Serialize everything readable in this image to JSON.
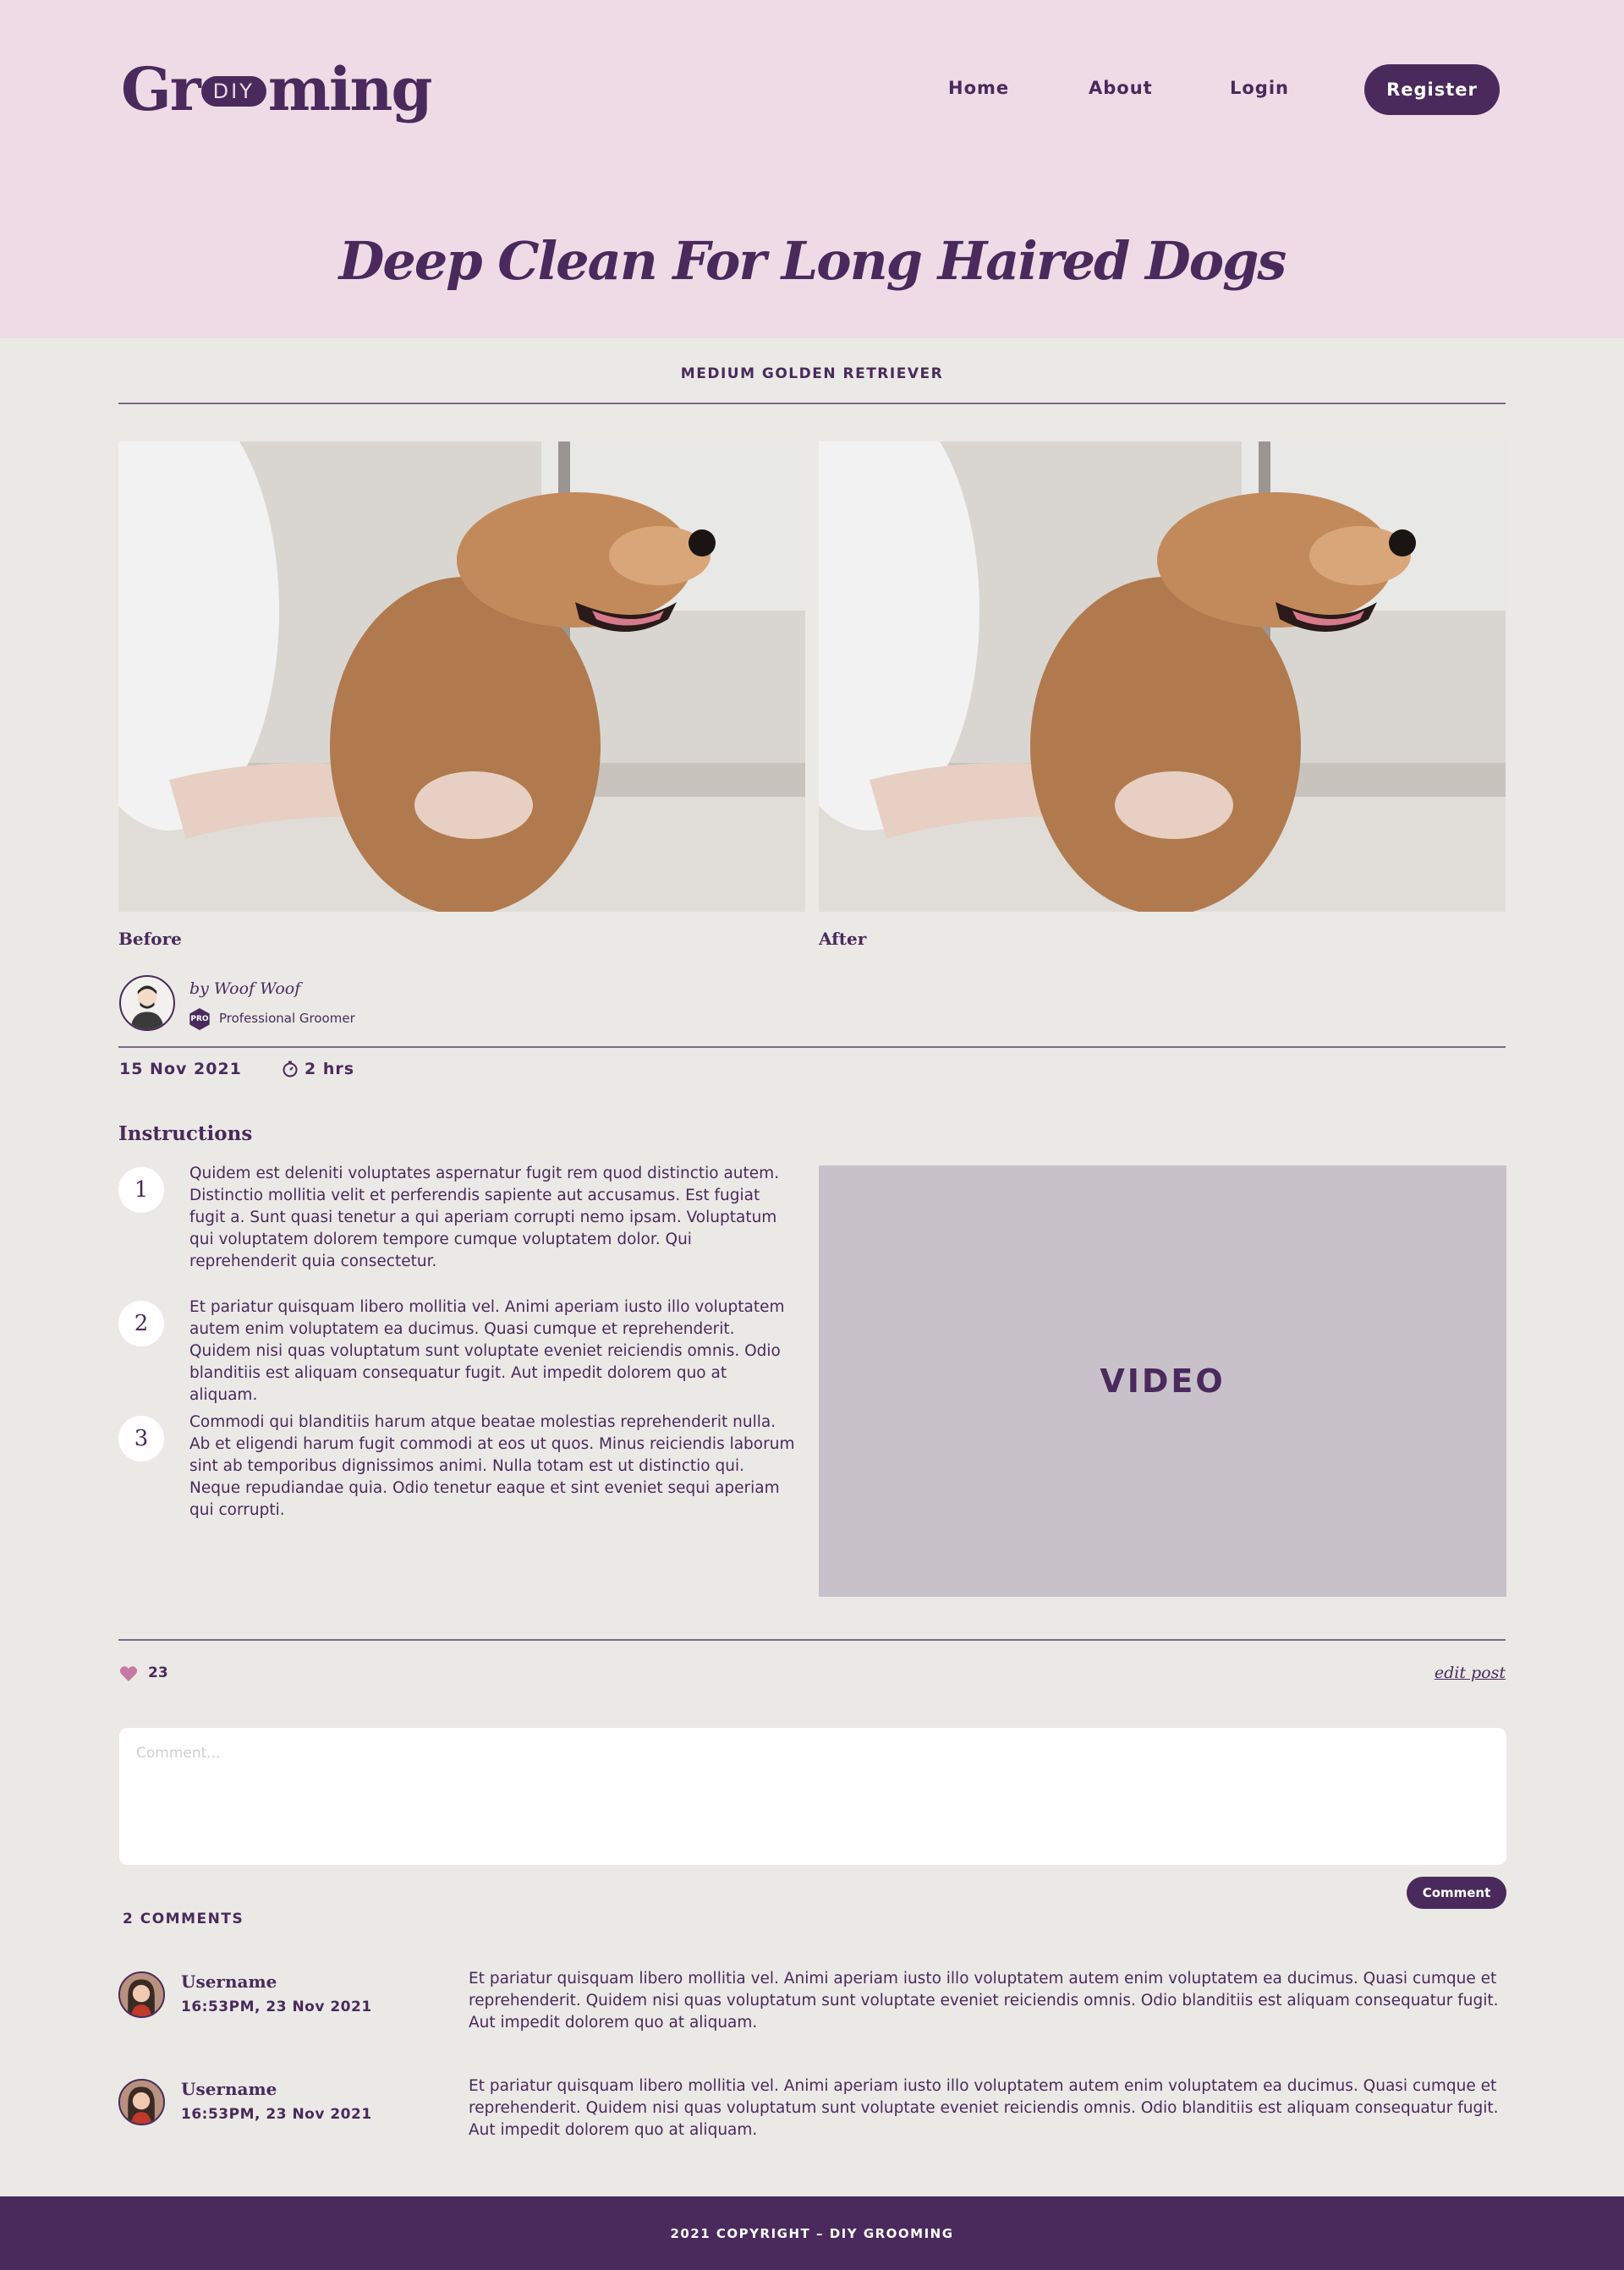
{
  "header": {
    "logo_left": "Gr",
    "logo_pill": "DIY",
    "logo_right": "ming",
    "nav": {
      "home": "Home",
      "about": "About",
      "login": "Login",
      "register": "Register"
    }
  },
  "post": {
    "title": "Deep Clean For Long Haired Dogs",
    "breed": "MEDIUM GOLDEN RETRIEVER",
    "before_label": "Before",
    "after_label": "After",
    "author": {
      "name": "by Woof Woof",
      "badge": "PRO",
      "role": "Professional Groomer"
    },
    "date": "15 Nov 2021",
    "duration": "2 hrs",
    "instructions_title": "Instructions",
    "steps": [
      {
        "number": "1",
        "text": "Quidem est deleniti voluptates aspernatur fugit rem quod distinctio autem. Distinctio mollitia velit et perferendis sapiente aut accusamus. Est fugiat fugit a. Sunt quasi tenetur a qui aperiam corrupti nemo ipsam. Voluptatum qui voluptatem dolorem tempore cumque voluptatem dolor. Qui reprehenderit quia consectetur."
      },
      {
        "number": "2",
        "text": "Et pariatur quisquam libero mollitia vel. Animi aperiam iusto illo voluptatem autem enim voluptatem ea ducimus. Quasi cumque et reprehenderit. Quidem nisi quas voluptatum sunt voluptate eveniet reiciendis omnis. Odio blanditiis est aliquam consequatur fugit. Aut impedit dolorem quo at aliquam."
      },
      {
        "number": "3",
        "text": "Commodi qui blanditiis harum atque beatae molestias reprehenderit nulla. Ab et eligendi harum fugit commodi at eos ut quos. Minus reiciendis laborum sint ab temporibus dignissimos animi. Nulla totam est ut distinctio qui. Neque repudiandae quia. Odio tenetur eaque et sint eveniet sequi aperiam qui corrupti."
      }
    ],
    "video_label": "VIDEO",
    "likes": "23",
    "edit_label": "edit post"
  },
  "comment_form": {
    "placeholder": "Comment...",
    "submit_label": "Comment"
  },
  "comments": {
    "count_label": "2 COMMENTS",
    "items": [
      {
        "user": "Username",
        "time": "16:53PM, 23 Nov 2021",
        "text": "Et pariatur quisquam libero mollitia vel. Animi aperiam iusto illo voluptatem autem enim voluptatem ea ducimus. Quasi cumque et reprehenderit. Quidem nisi quas voluptatum sunt voluptate eveniet reiciendis omnis. Odio blanditiis est aliquam consequatur fugit. Aut impedit dolorem quo at aliquam."
      },
      {
        "user": "Username",
        "time": "16:53PM, 23 Nov 2021",
        "text": "Et pariatur quisquam libero mollitia vel. Animi aperiam iusto illo voluptatem autem enim voluptatem ea ducimus. Quasi cumque et reprehenderit. Quidem nisi quas voluptatum sunt voluptate eveniet reiciendis omnis. Odio blanditiis est aliquam consequatur fugit. Aut impedit dolorem quo at aliquam."
      }
    ]
  },
  "footer": {
    "copyright": "2021 COPYRIGHT – DIY GROOMING"
  },
  "colors": {
    "brand": "#4a2a5c",
    "hero_bg": "#eedbe6",
    "page_bg": "#ebe9e6",
    "video_bg": "#c9c1ca",
    "heart": "#c77aa6"
  },
  "icons": {
    "timer": "timer-icon",
    "like": "heart-icon",
    "pro": "pro-badge-icon"
  }
}
